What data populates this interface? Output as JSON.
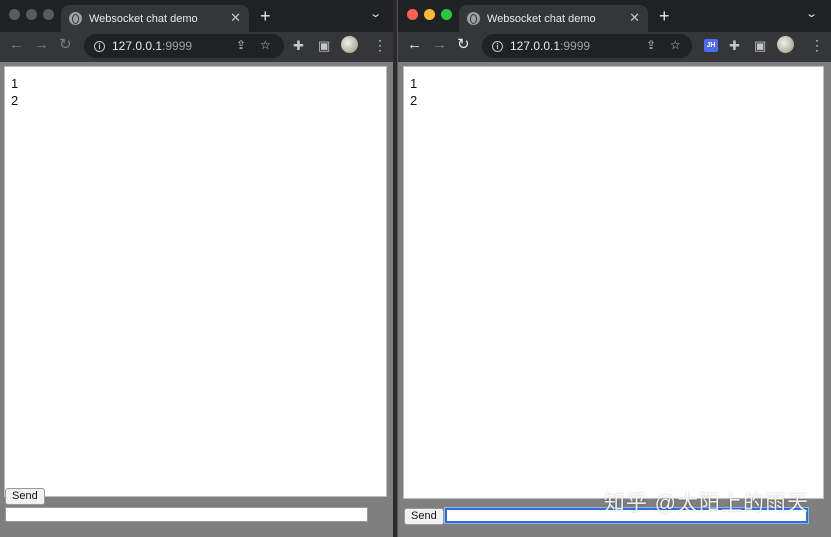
{
  "left_window": {
    "tab": {
      "title": "Websocket chat demo"
    },
    "omnibox": {
      "host": "127.0.0.1",
      "port": ":9999"
    },
    "messages": [
      "1",
      "2"
    ],
    "send_label": "Send",
    "input_value": ""
  },
  "right_window": {
    "tab": {
      "title": "Websocket chat demo"
    },
    "omnibox": {
      "host": "127.0.0.1",
      "port": ":9999"
    },
    "extension_badge": "JH",
    "messages": [
      "1",
      "2"
    ],
    "send_label": "Send",
    "input_value": ""
  },
  "watermark": "知乎 @太阳上的雨天",
  "icons": {
    "favicon": "globe-icon",
    "back": "back-arrow-icon",
    "forward": "forward-arrow-icon",
    "reload": "reload-icon",
    "info": "info-icon",
    "share": "share-icon",
    "bookmark": "star-icon",
    "extensions": "puzzle-icon",
    "sidepanel": "side-panel-icon",
    "menu": "kebab-menu-icon"
  },
  "colors": {
    "chrome_dark": "#202124",
    "toolbar": "#35363a",
    "traffic_red": "#ff5f57",
    "traffic_yellow": "#febc2e",
    "traffic_green": "#28c840",
    "focus_ring": "#2f6fd6"
  }
}
